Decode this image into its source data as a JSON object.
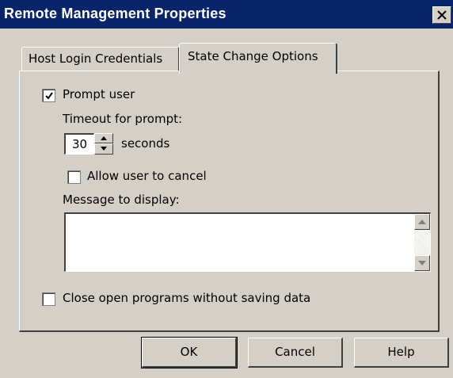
{
  "window": {
    "title": "Remote Management Properties",
    "close_glyph": "X"
  },
  "tabs": [
    {
      "label": "Host Login Credentials",
      "active": false
    },
    {
      "label": "State Change Options",
      "active": true
    }
  ],
  "options": {
    "prompt_user": {
      "label": "Prompt user",
      "checked": true
    },
    "timeout_label": "Timeout for prompt:",
    "timeout_value": "30",
    "timeout_unit": "seconds",
    "allow_cancel": {
      "label": "Allow user to cancel",
      "checked": false
    },
    "message_label": "Message to display:",
    "message_value": "",
    "close_programs": {
      "label": "Close open programs without saving data",
      "checked": false
    }
  },
  "buttons": {
    "ok": "OK",
    "cancel": "Cancel",
    "help": "Help"
  },
  "colors": {
    "titlebar": "#0a246a",
    "face": "#d4d0c8",
    "field": "#ffffff"
  }
}
